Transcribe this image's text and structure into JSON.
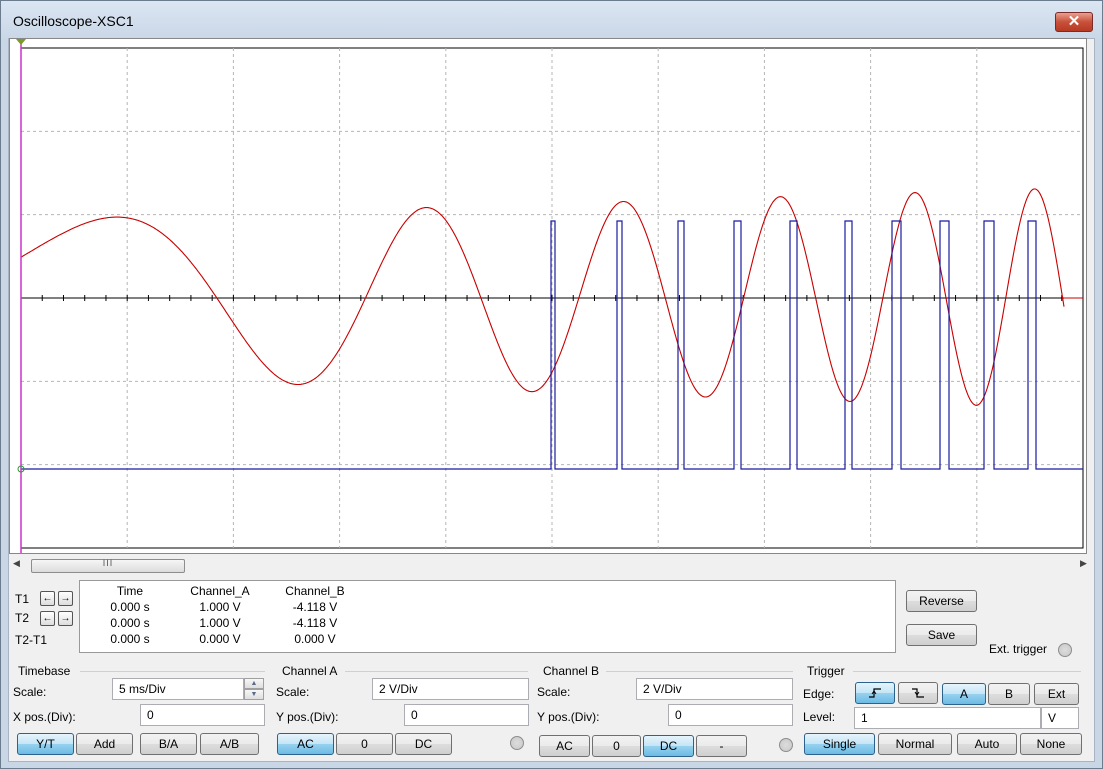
{
  "window": {
    "title": "Oscilloscope-XSC1",
    "close_label": "✕"
  },
  "scrollbar": {
    "left_arrow": "◀",
    "right_arrow": "▶",
    "thumb_grip": "III"
  },
  "readout": {
    "headers": [
      "Time",
      "Channel_A",
      "Channel_B"
    ],
    "rows": [
      {
        "label": "T1",
        "time": "0.000 s",
        "a": "1.000 V",
        "b": "-4.118 V"
      },
      {
        "label": "T2",
        "time": "0.000 s",
        "a": "1.000 V",
        "b": "-4.118 V"
      },
      {
        "label": "T2-T1",
        "time": "0.000 s",
        "a": "0.000 V",
        "b": "0.000 V"
      }
    ],
    "left_arrow": "←",
    "right_arrow": "→"
  },
  "buttons": {
    "reverse": "Reverse",
    "save": "Save",
    "ext_trigger": "Ext. trigger"
  },
  "timebase": {
    "title": "Timebase",
    "scale_label": "Scale:",
    "scale_value": "5 ms/Div",
    "xpos_label": "X pos.(Div):",
    "xpos_value": "0",
    "modes": [
      "Y/T",
      "Add",
      "B/A",
      "A/B"
    ],
    "active_mode": "Y/T"
  },
  "channel_a": {
    "title": "Channel A",
    "scale_label": "Scale:",
    "scale_value": "2  V/Div",
    "ypos_label": "Y pos.(Div):",
    "ypos_value": "0",
    "coupling": [
      "AC",
      "0",
      "DC"
    ],
    "active": "AC"
  },
  "channel_b": {
    "title": "Channel B",
    "scale_label": "Scale:",
    "scale_value": "2  V/Div",
    "ypos_label": "Y pos.(Div):",
    "ypos_value": "0",
    "coupling": [
      "AC",
      "0",
      "DC",
      "-"
    ],
    "active": "DC"
  },
  "trigger": {
    "title": "Trigger",
    "edge_label": "Edge:",
    "level_label": "Level:",
    "level_value": "1",
    "level_unit": "V",
    "sources": [
      "A",
      "B",
      "Ext"
    ],
    "active_source": "A",
    "modes": [
      "Single",
      "Normal",
      "Auto",
      "None"
    ],
    "active_mode": "Single",
    "rising_edge_icon": "rising-edge",
    "falling_edge_icon": "falling-edge"
  },
  "chart_data": {
    "type": "line",
    "x_divisions": 10,
    "y_divisions": 6,
    "series": [
      {
        "color": "#c80000",
        "shape": "chirp sine, frequency increasing left to right, amplitude ~1 div"
      },
      {
        "color": "#1a1aa0",
        "shape": "pulse train starting near mid-screen, increasing pulse rate"
      }
    ],
    "colors": {
      "channel_a": "#c80000",
      "channel_b": "#1a1aa0",
      "cursor_t1": "#cc33cc",
      "grid": "#b5b5b5",
      "axis": "#000000"
    }
  }
}
